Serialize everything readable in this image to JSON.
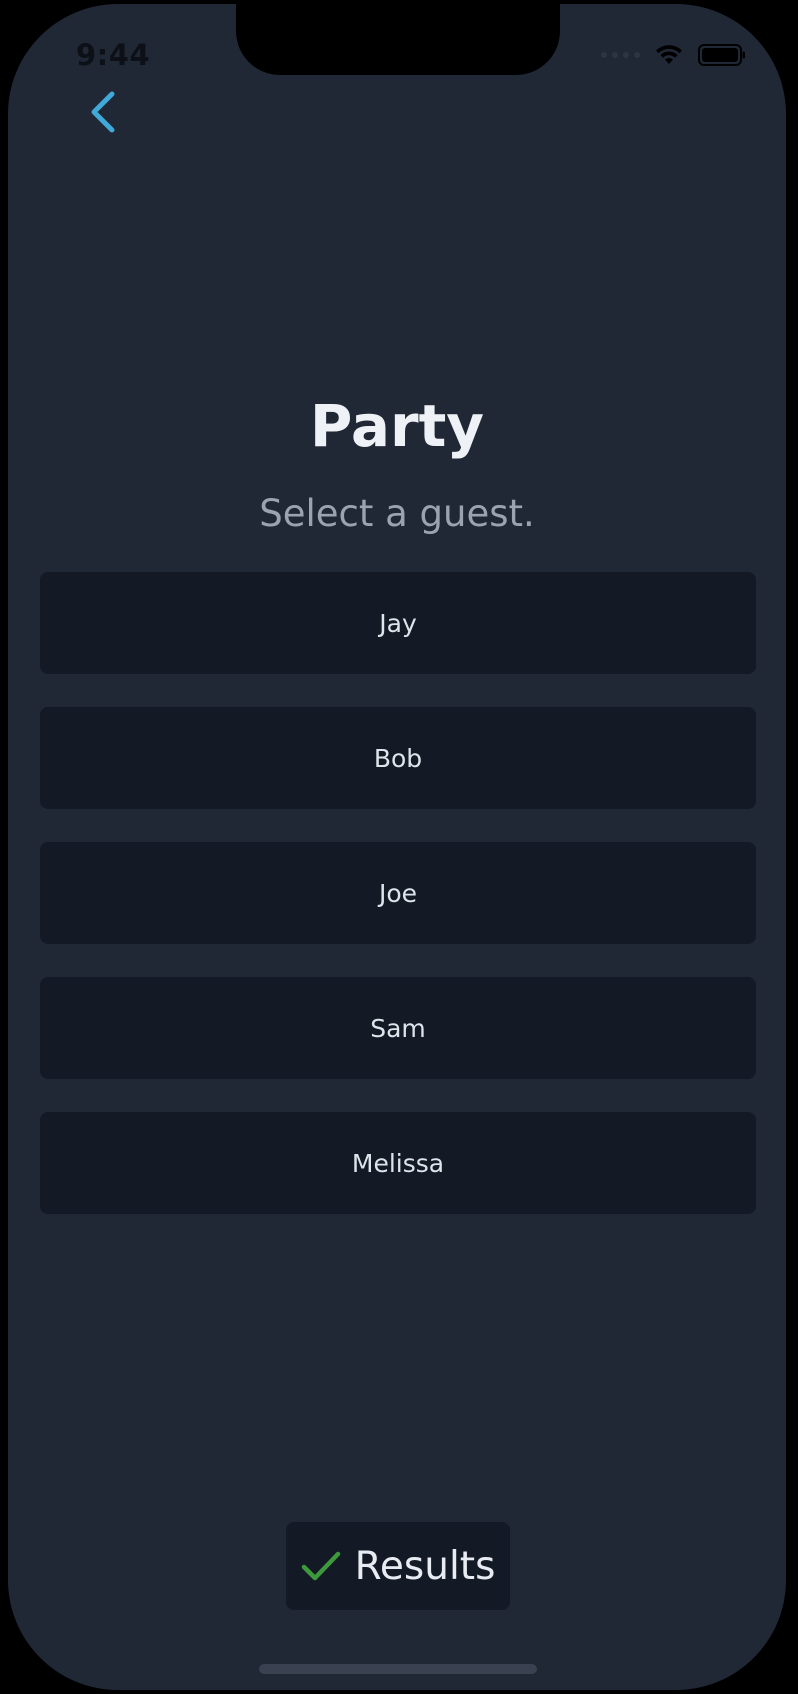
{
  "status_bar": {
    "time": "9:44"
  },
  "nav": {
    "back_icon": "chevron-left-icon",
    "accent_color": "#3fa9d8"
  },
  "header": {
    "title": "Party",
    "subtitle": "Select a guest."
  },
  "guests": [
    {
      "name": "Jay"
    },
    {
      "name": "Bob"
    },
    {
      "name": "Joe"
    },
    {
      "name": "Sam"
    },
    {
      "name": "Melissa"
    }
  ],
  "results_button": {
    "label": "Results",
    "icon": "checkmark-icon",
    "icon_color": "#3c9a3c"
  }
}
